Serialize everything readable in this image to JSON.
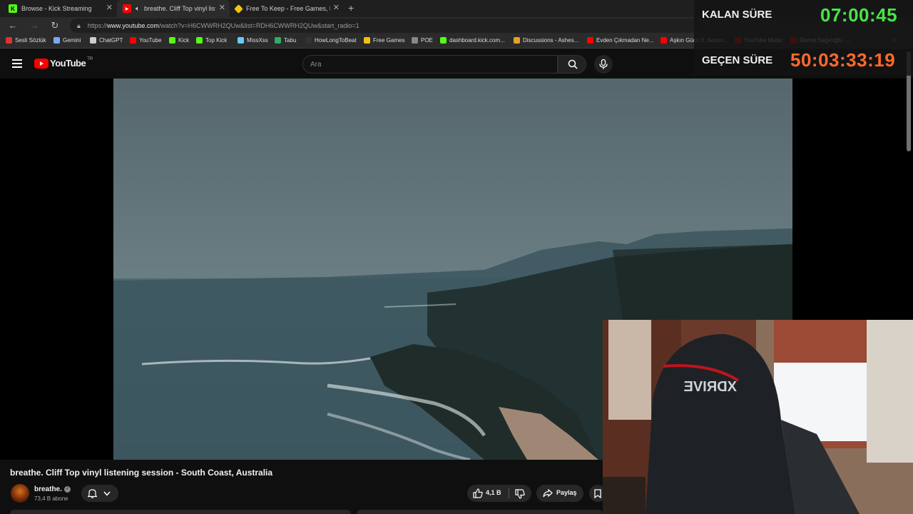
{
  "browser": {
    "tabs": [
      {
        "title": "Browse - Kick Streaming",
        "favicon": "kick-icon",
        "color": "#53fc18",
        "active": false
      },
      {
        "title": "breathe. Cliff Top vinyl listen",
        "favicon": "youtube-icon",
        "color": "#ff0000",
        "active": true
      },
      {
        "title": "Free To Keep - Free Games, Every",
        "favicon": "tag-icon",
        "color": "#f4c20d",
        "active": false
      }
    ],
    "new_tab": "+",
    "url_prefix": "https://",
    "url_host": "www.youtube.com",
    "url_path": "/watch?v=H6CWWRH2QUw&list=RDH6CWWRH2QUw&start_radio=1"
  },
  "bookmarks": [
    {
      "label": "Sesli Sözlük",
      "color": "#d33"
    },
    {
      "label": "Gemini",
      "color": "#7aa7ff"
    },
    {
      "label": "ChatGPT",
      "color": "#cfcfcf"
    },
    {
      "label": "YouTube",
      "color": "#ff0000"
    },
    {
      "label": "Kick",
      "color": "#53fc18"
    },
    {
      "label": "Top Kick",
      "color": "#53fc18"
    },
    {
      "label": "MissXss",
      "color": "#6cf"
    },
    {
      "label": "Tabu",
      "color": "#3a6"
    },
    {
      "label": "HowLongToBeat",
      "color": "#333"
    },
    {
      "label": "Free Games",
      "color": "#f4c20d"
    },
    {
      "label": "POE",
      "color": "#888"
    },
    {
      "label": "dashboard.kick.com...",
      "color": "#53fc18"
    },
    {
      "label": "Discussions - Ashes...",
      "color": "#e2a22a"
    },
    {
      "label": "Evden Çıkmadan Ne...",
      "color": "#ff0000"
    },
    {
      "label": "Aşkın Gücü 3. Sezon...",
      "color": "#ff0000"
    },
    {
      "label": "YouTube Music",
      "color": "#ff0000"
    },
    {
      "label": "Demet Sağıroğlu -...",
      "color": "#ff0000"
    }
  ],
  "youtube": {
    "logo_text": "YouTube",
    "country": "TR",
    "search_placeholder": "Ara",
    "video_title": "breathe. Cliff Top vinyl listening session - South Coast, Australia",
    "channel_name": "breathe.",
    "subscribers": "73,4 B abone",
    "likes": "4,1 B",
    "share_label": "Paylaş"
  },
  "stream_overlay": {
    "remaining_label": "KALAN SÜRE",
    "remaining_value": "07:00:45",
    "elapsed_label": "GEÇEN SÜRE",
    "elapsed_value": "50:03:33:19"
  },
  "webcam": {
    "chair_brand": "XDRIVE"
  }
}
